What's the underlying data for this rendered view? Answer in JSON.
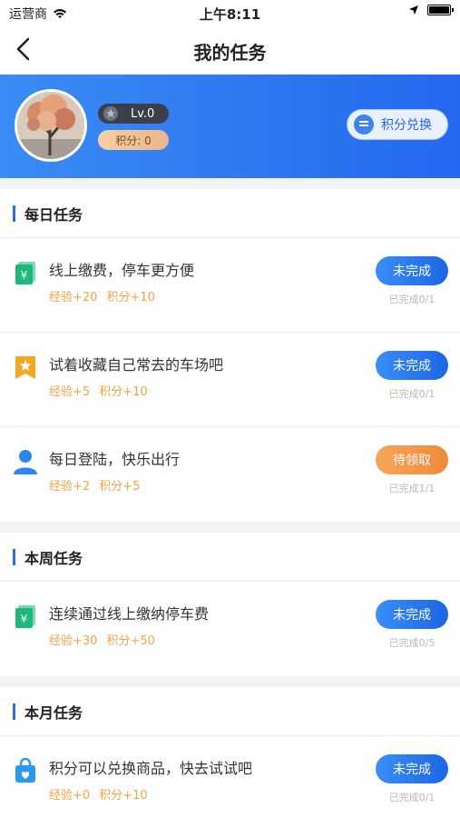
{
  "status_bar": {
    "carrier": "运营商",
    "time": "上午8:11"
  },
  "header": {
    "title": "我的任务"
  },
  "profile": {
    "level": "Lv.0",
    "points": "积分: 0",
    "exchange_label": "积分兑换"
  },
  "sections": [
    {
      "title": "每日任务",
      "tasks": [
        {
          "icon": "money-icon",
          "title": "线上缴费，停车更方便",
          "exp": "经验+20",
          "points": "积分+10",
          "button": "未完成",
          "progress": "已完成0/1"
        },
        {
          "icon": "bookmark-star-icon",
          "title": "试着收藏自己常去的车场吧",
          "exp": "经验+5",
          "points": "积分+10",
          "button": "未完成",
          "progress": "已完成0/1"
        },
        {
          "icon": "user-icon",
          "title": "每日登陆，快乐出行",
          "exp": "经验+2",
          "points": "积分+5",
          "button": "待领取",
          "progress": "已完成1/1"
        }
      ]
    },
    {
      "title": "本周任务",
      "tasks": [
        {
          "icon": "money-icon",
          "title": "连续通过线上缴纳停车费",
          "exp": "经验+30",
          "points": "积分+50",
          "button": "未完成",
          "progress": "已完成0/5"
        }
      ]
    },
    {
      "title": "本月任务",
      "tasks": [
        {
          "icon": "shopping-bag-icon",
          "title": "积分可以兑换商品，快去试试吧",
          "exp": "经验+0",
          "points": "积分+10",
          "button": "未完成",
          "progress": "已完成0/1"
        }
      ]
    }
  ],
  "colors": {
    "accent_blue": "#2468ef",
    "orange": "#f08a3a",
    "reward_orange": "#f1a346",
    "money_green": "#1db87a",
    "bookmark_orange": "#f5a623"
  }
}
